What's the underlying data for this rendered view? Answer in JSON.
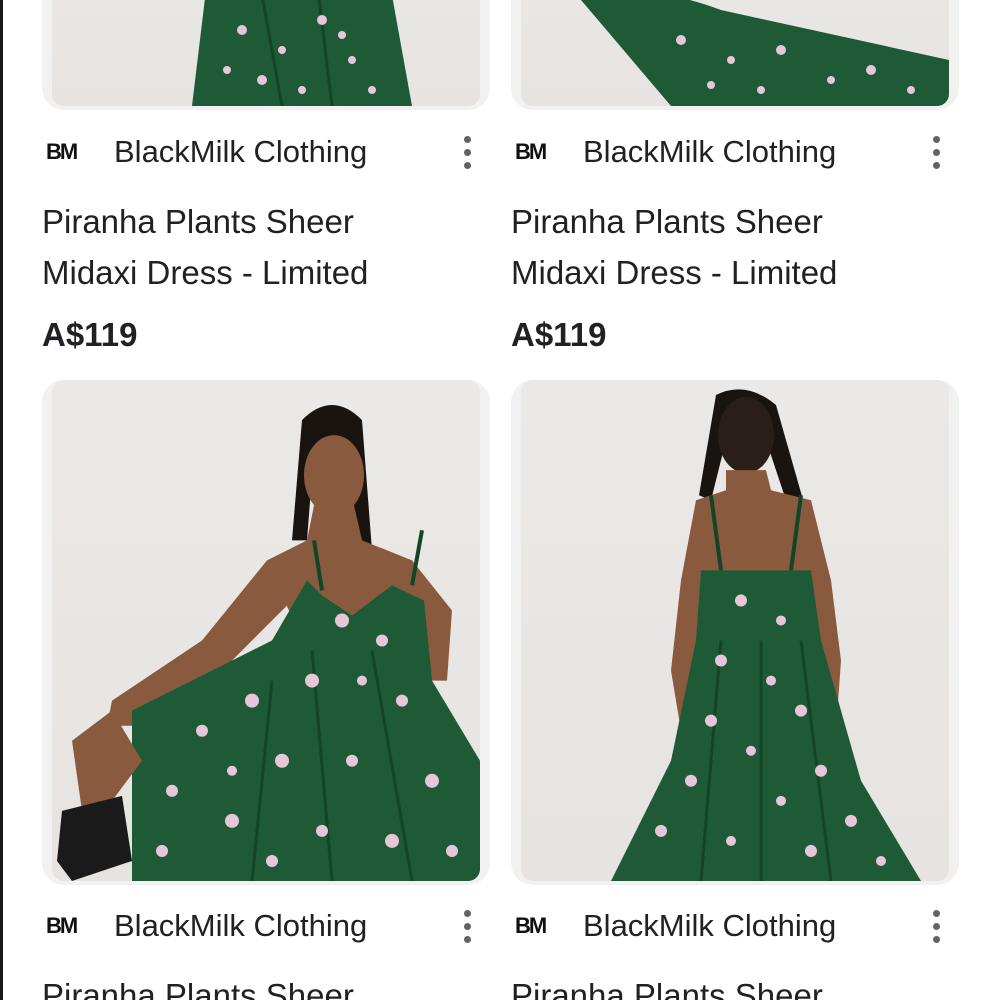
{
  "products": [
    {
      "merchant_logo": "BM",
      "merchant": "BlackMilk Clothing",
      "title_line1": "Piranha Plants Sheer",
      "title_line2": "Midaxi Dress - Limited",
      "price": "A$119",
      "more_icon": "more-vert-icon"
    },
    {
      "merchant_logo": "BM",
      "merchant": "BlackMilk Clothing",
      "title_line1": "Piranha Plants Sheer",
      "title_line2": "Midaxi Dress - Limited",
      "price": "A$119",
      "more_icon": "more-vert-icon"
    },
    {
      "merchant_logo": "BM",
      "merchant": "BlackMilk Clothing",
      "title_line1": "Piranha Plants Sheer",
      "more_icon": "more-vert-icon"
    },
    {
      "merchant_logo": "BM",
      "merchant": "BlackMilk Clothing",
      "title_line1": "Piranha Plants Sheer",
      "more_icon": "more-vert-icon"
    }
  ],
  "colors": {
    "dress": "#1d5a35",
    "dress_dark": "#134427",
    "print": "#e7c6d8",
    "background": "#e8e6e3",
    "skin": "#8a5a3f"
  }
}
